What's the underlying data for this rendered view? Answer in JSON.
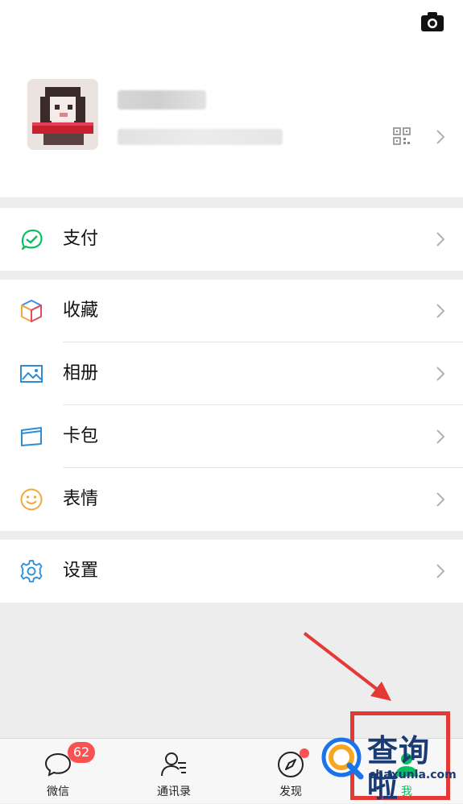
{
  "profile": {
    "name": "",
    "wechat_id": ""
  },
  "menu": {
    "pay": {
      "label": "支付",
      "icon": "wallet-check-icon"
    },
    "favorites": {
      "label": "收藏",
      "icon": "cube-icon"
    },
    "album": {
      "label": "相册",
      "icon": "image-icon"
    },
    "cards": {
      "label": "卡包",
      "icon": "card-icon"
    },
    "stickers": {
      "label": "表情",
      "icon": "smiley-icon"
    },
    "settings": {
      "label": "设置",
      "icon": "gear-icon"
    }
  },
  "tabbar": {
    "chats": {
      "label": "微信",
      "badge": "62",
      "icon": "chat-bubble-icon"
    },
    "contacts": {
      "label": "通讯录",
      "icon": "contacts-icon"
    },
    "discover": {
      "label": "发现",
      "icon": "compass-icon",
      "has_dot": true
    },
    "me": {
      "label": "我",
      "icon": "person-icon",
      "selected": true
    }
  },
  "watermark": {
    "text": "查询啦",
    "url": "chaxunla.com"
  },
  "colors": {
    "accent_green": "#07c160",
    "badge_red": "#fa5151",
    "annotation_red": "#e53935",
    "background": "#ededed"
  }
}
